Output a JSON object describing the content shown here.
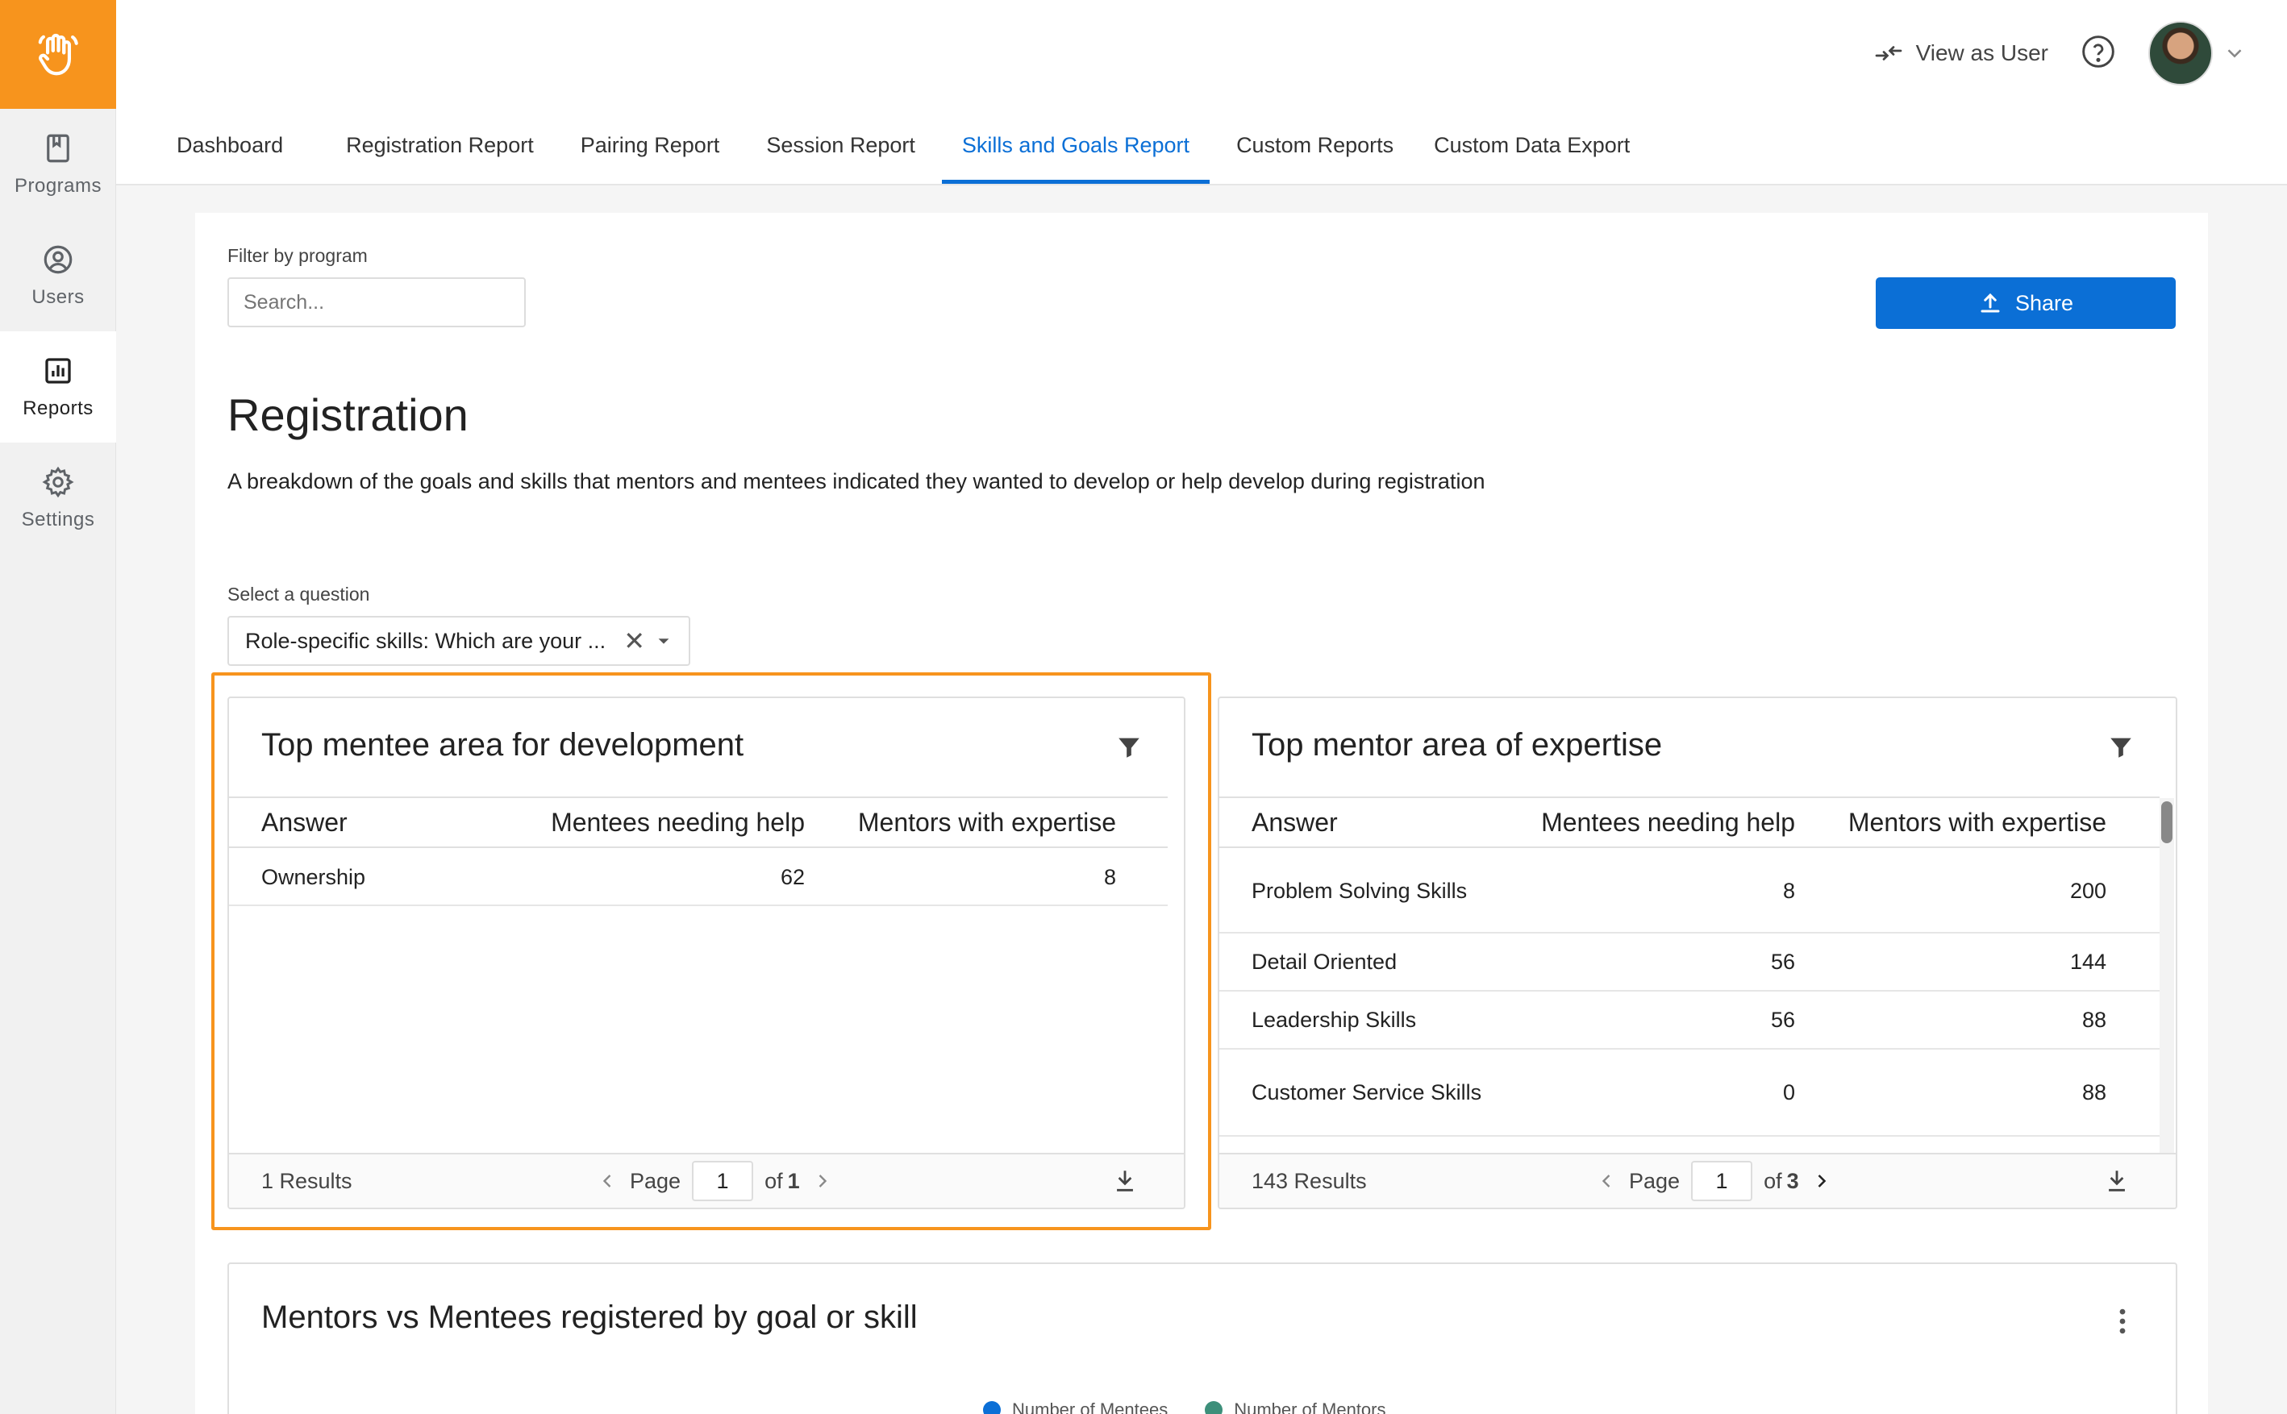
{
  "sidebar": {
    "items": [
      {
        "label": "Programs",
        "icon": "bookmark-icon"
      },
      {
        "label": "Users",
        "icon": "user-circle-icon"
      },
      {
        "label": "Reports",
        "icon": "bar-chart-icon",
        "active": true
      },
      {
        "label": "Settings",
        "icon": "gear-icon"
      }
    ]
  },
  "topbar": {
    "view_as_user": "View as User"
  },
  "tabs": [
    {
      "label": "Dashboard"
    },
    {
      "label": "Registration Report"
    },
    {
      "label": "Pairing Report"
    },
    {
      "label": "Session Report"
    },
    {
      "label": "Skills and Goals Report",
      "active": true
    },
    {
      "label": "Custom Reports"
    },
    {
      "label": "Custom Data Export"
    }
  ],
  "filter": {
    "label": "Filter by program",
    "placeholder": "Search..."
  },
  "share_label": "Share",
  "page": {
    "title": "Registration",
    "description": "A breakdown of the goals and skills that mentors and mentees indicated they wanted to develop or help develop during registration"
  },
  "question": {
    "label": "Select a question",
    "value": "Role-specific skills: Which are your ..."
  },
  "mentee_table": {
    "title": "Top mentee area for development",
    "columns": [
      "Answer",
      "Mentees needing help",
      "Mentors with expertise"
    ],
    "rows": [
      {
        "answer": "Ownership",
        "mentees": "62",
        "mentors": "8"
      }
    ],
    "results": "1 Results",
    "page_label": "Page",
    "page": "1",
    "of_label": "of",
    "total_pages": "1"
  },
  "mentor_table": {
    "title": "Top mentor area of expertise",
    "columns": [
      "Answer",
      "Mentees needing help",
      "Mentors with expertise"
    ],
    "rows": [
      {
        "answer": "Problem Solving Skills",
        "mentees": "8",
        "mentors": "200"
      },
      {
        "answer": "Detail Oriented",
        "mentees": "56",
        "mentors": "144"
      },
      {
        "answer": "Leadership Skills",
        "mentees": "56",
        "mentors": "88"
      },
      {
        "answer": "Customer Service Skills",
        "mentees": "0",
        "mentors": "88"
      }
    ],
    "results": "143 Results",
    "page_label": "Page",
    "page": "1",
    "of_label": "of",
    "total_pages": "3"
  },
  "chart": {
    "title": "Mentors vs Mentees registered by goal or skill",
    "legend": [
      {
        "label": "Number of Mentees",
        "color": "#0b6fd6"
      },
      {
        "label": "Number of Mentors",
        "color": "#3d8f7a"
      }
    ]
  },
  "colors": {
    "accent": "#0b6fd6",
    "brand": "#f7941d"
  }
}
